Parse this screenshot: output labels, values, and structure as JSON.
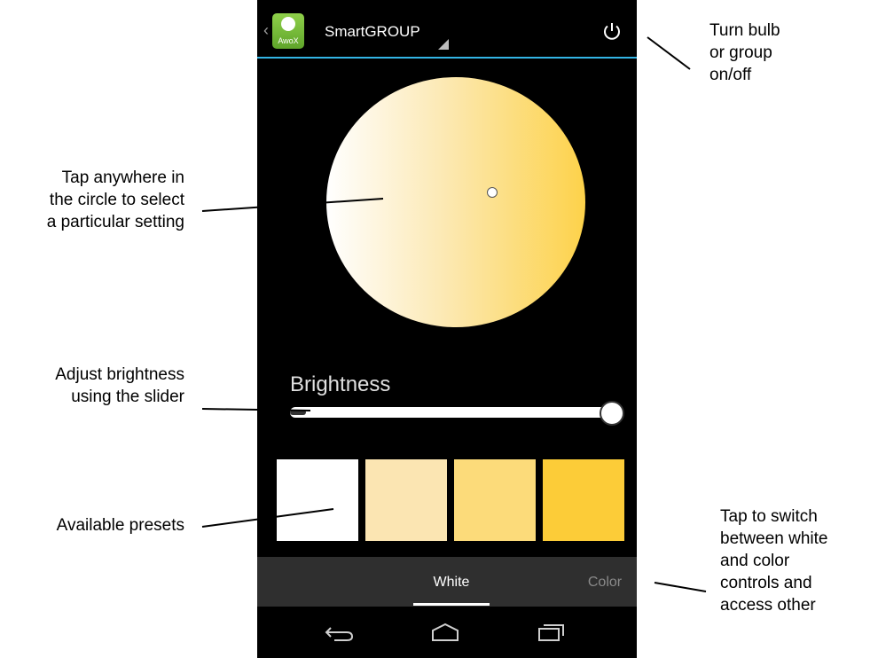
{
  "app": {
    "title": "SmartGROUP",
    "icon_caption": "AwoX",
    "accent_color": "#33b5e5",
    "brand_icon_color": "#76bc3a"
  },
  "controls": {
    "brightness_label": "Brightness",
    "brightness_level": 1.0,
    "presets": [
      {
        "color": "#ffffff"
      },
      {
        "color": "#fbe5b2"
      },
      {
        "color": "#fcdb7a"
      },
      {
        "color": "#fccc38"
      }
    ]
  },
  "tabs": {
    "white": "White",
    "color": "Color",
    "active": "White"
  },
  "annotations": {
    "power": [
      "Turn bulb",
      "or group",
      "on/off"
    ],
    "circle": [
      "Tap anywhere in",
      "the circle to select",
      "a particular setting"
    ],
    "brightness": [
      "Adjust brightness",
      "using the slider"
    ],
    "presets": [
      "Available presets"
    ],
    "tabs": [
      "Tap to switch",
      "between white",
      "and color",
      "controls and",
      "access other"
    ]
  }
}
